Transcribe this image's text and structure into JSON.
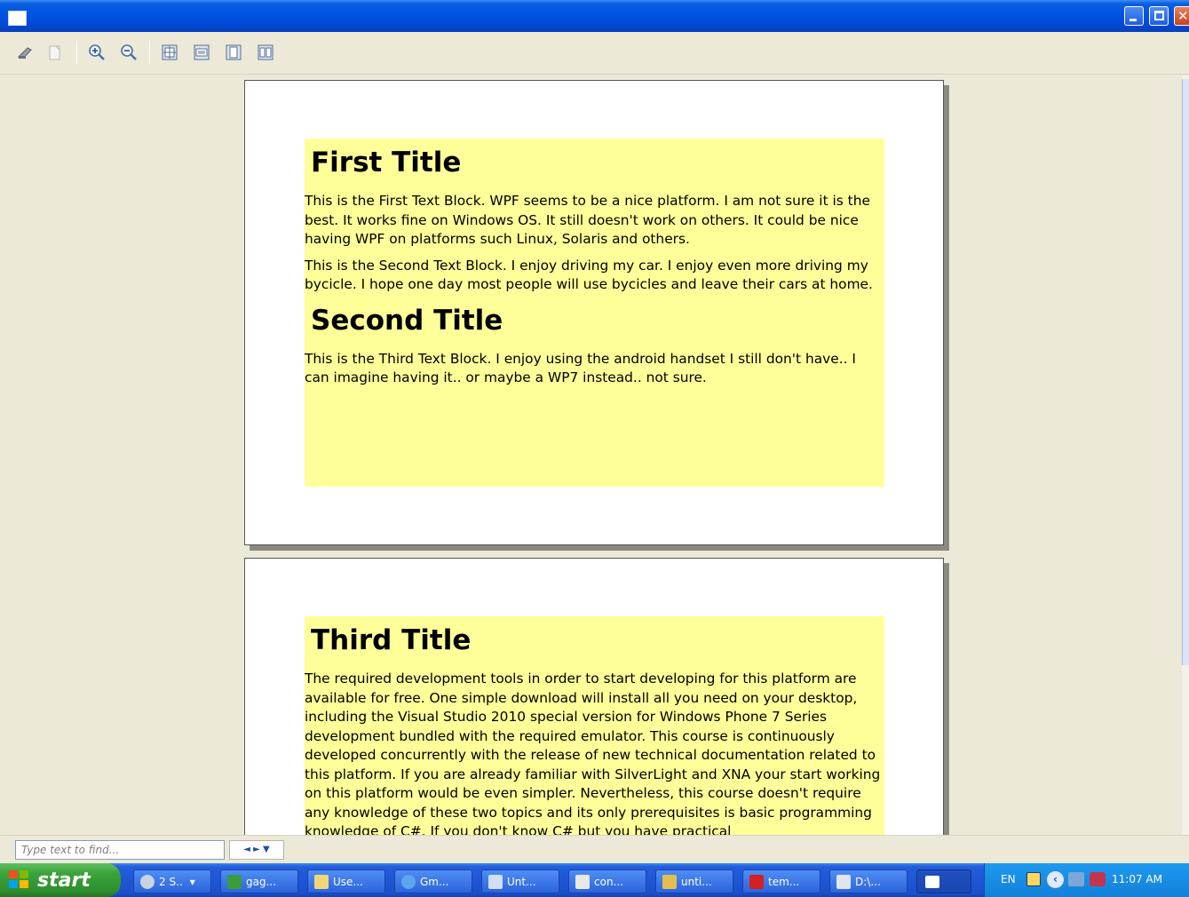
{
  "window": {
    "title": ""
  },
  "toolbar": {
    "buttons": [
      {
        "name": "print-button",
        "icon": "printer-icon"
      },
      {
        "name": "copy-button",
        "icon": "copy-icon"
      },
      {
        "name": "zoom-in-button",
        "icon": "zoom-in-icon"
      },
      {
        "name": "zoom-out-button",
        "icon": "zoom-out-icon"
      },
      {
        "name": "actual-size-button",
        "icon": "actual-size-icon"
      },
      {
        "name": "page-width-button",
        "icon": "page-width-icon"
      },
      {
        "name": "whole-page-button",
        "icon": "whole-page-icon"
      },
      {
        "name": "two-pages-button",
        "icon": "two-pages-icon"
      }
    ]
  },
  "document": {
    "page1": {
      "title1": "First Title",
      "para1": "This is the First Text Block. WPF seems to be a nice platform. I am not sure it is the best. It works fine on Windows OS. It still doesn't work on others. It could be nice having WPF on platforms such Linux, Solaris and others.",
      "para2": "This is the Second Text Block. I enjoy driving my car. I enjoy even more driving my bycicle. I hope one day most people will use bycicles and leave their cars at home.",
      "title2": "Second Title",
      "para3": "This is the Third Text Block. I enjoy using the android handset I still don't have.. I can imagine having it.. or maybe a WP7 instead.. not sure."
    },
    "page2": {
      "title": "Third Title",
      "para": "The required development tools in order to start developing for this platform are available for free. One simple download will install all you need on your desktop, including the Visual Studio 2010 special version for Windows Phone 7 Series development bundled with the required emulator. This course is continuously developed concurrently with the release of new technical documentation related to this platform. If you are already familiar with SilverLight and XNA your start working on this platform would be even simpler. Nevertheless, this course doesn't require any knowledge of these two topics and its only prerequisites is basic programming knowledge of C#. If you don't know C# but you have practical"
    }
  },
  "find": {
    "placeholder": "Type text to find...",
    "nav": "◄ ► ▼"
  },
  "taskbar": {
    "start_label": "start",
    "tasks": [
      "2 S..",
      "gag...",
      "Use...",
      "Gm...",
      "Unt...",
      "con...",
      "unti...",
      "tem...",
      "D:\\...",
      ""
    ],
    "language": "EN",
    "clock": "11:07 AM"
  },
  "colors": {
    "highlight": "#FFFF99",
    "titlebar": "#0055E5",
    "taskbar": "#245EDB",
    "start": "#3BA33B"
  }
}
